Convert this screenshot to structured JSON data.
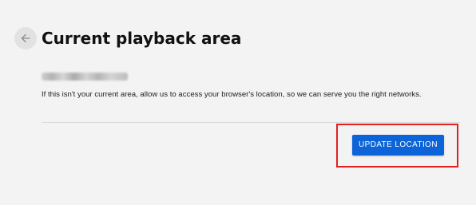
{
  "header": {
    "title": "Current playback area",
    "back_icon": "arrow-left-icon"
  },
  "main": {
    "location_value_redacted": true,
    "description": "If this isn't your current area, allow us to access your browser's location, so we can serve you the right networks.",
    "update_button_label": "UPDATE LOCATION"
  },
  "colors": {
    "background": "#f3f3f3",
    "button_primary": "#0c64d8",
    "highlight_annotation": "#e02020"
  }
}
